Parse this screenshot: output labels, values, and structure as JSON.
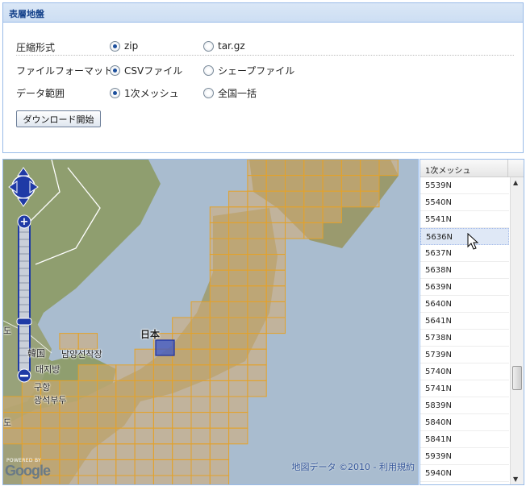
{
  "panel": {
    "title": "表層地盤"
  },
  "form": {
    "compression": {
      "label": "圧縮形式",
      "options": [
        {
          "label": "zip",
          "selected": true
        },
        {
          "label": "tar.gz",
          "selected": false
        }
      ]
    },
    "file_format": {
      "label": "ファイルフォーマット",
      "options": [
        {
          "label": "CSVファイル",
          "selected": true
        },
        {
          "label": "シェープファイル",
          "selected": false
        }
      ]
    },
    "data_range": {
      "label": "データ範囲",
      "options": [
        {
          "label": "1次メッシュ",
          "selected": true
        },
        {
          "label": "全国一括",
          "selected": false
        }
      ]
    },
    "download_button": "ダウンロード開始"
  },
  "map": {
    "labels": {
      "japan": "日本",
      "korea": "韓国",
      "daejeon": "대지방",
      "namyang": "남양선착장",
      "guhang": "구항",
      "gwangseok": "광석부두",
      "edge_top": "도",
      "edge_bottom": "도"
    },
    "attribution": "地図データ ©2010 - 利用規約",
    "powered_by": "POWERED BY",
    "logo": "Google",
    "colors": {
      "mesh_fill": "#d6ab72",
      "mesh_border": "#e3a22a",
      "selected_fill": "#3a55c8"
    }
  },
  "grid": {
    "header": "1次メッシュ",
    "rows": [
      "5539N",
      "5540N",
      "5541N",
      "5636N",
      "5637N",
      "5638N",
      "5639N",
      "5640N",
      "5641N",
      "5738N",
      "5739N",
      "5740N",
      "5741N",
      "5839N",
      "5840N",
      "5841N",
      "5939N",
      "5940N"
    ],
    "selected_row": "5636N"
  }
}
